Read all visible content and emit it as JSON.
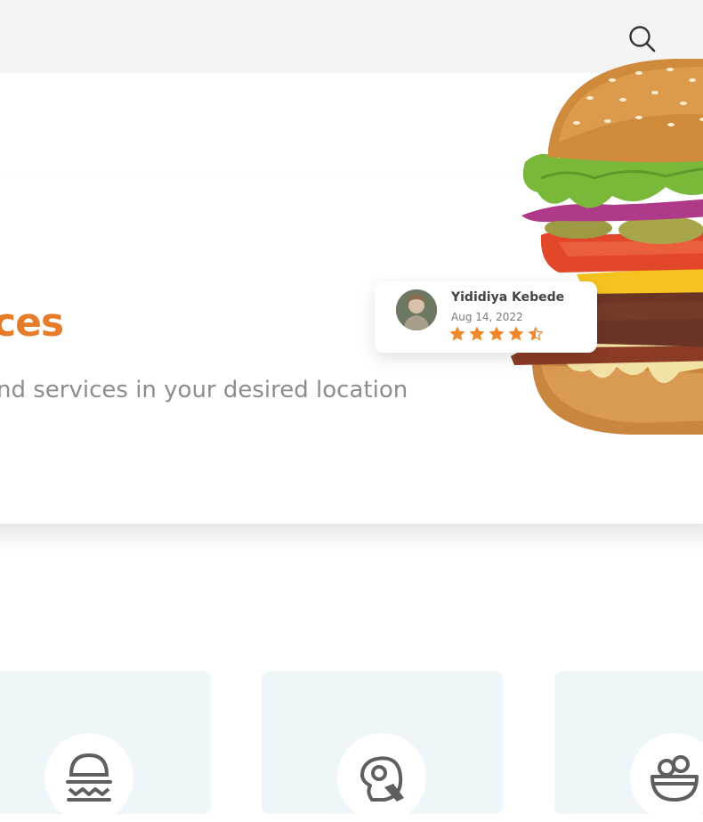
{
  "header": {
    "search_icon": "search-icon"
  },
  "hero": {
    "headline": "ces",
    "subtitle": "nd services in your desired location",
    "accent_color": "#e67b2a"
  },
  "review_card": {
    "reviewer_name": "Yididiya Kebede",
    "date": "Aug 14, 2022",
    "rating": 4.5,
    "max_rating": 5,
    "star_color": "#f0882b"
  },
  "categories": [
    {
      "icon": "burger-icon"
    },
    {
      "icon": "meat-icon"
    },
    {
      "icon": "bowl-icon"
    }
  ]
}
